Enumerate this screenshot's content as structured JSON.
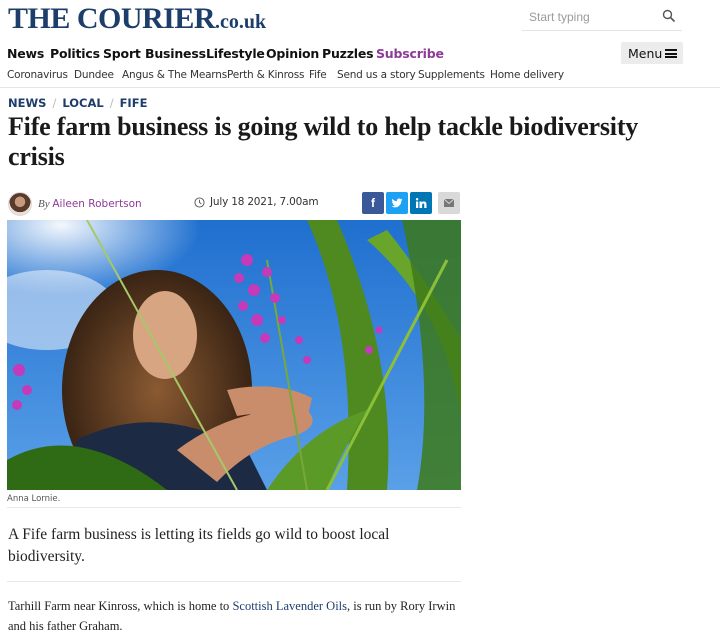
{
  "site": {
    "logo_main": "THE COURIER",
    "logo_tld": ".co.uk"
  },
  "search": {
    "placeholder": "Start typing",
    "icon": "search-icon"
  },
  "nav": {
    "items": [
      "News",
      "Politics",
      "Sport",
      "Business",
      "Lifestyle",
      "Opinion",
      "Puzzles",
      "Subscribe"
    ],
    "menu_label": "Menu",
    "subscribe_color": "#8e3a97"
  },
  "subnav": {
    "items": [
      "Coronavirus",
      "Dundee",
      "Angus & The Mearns",
      "Perth & Kinross",
      "Fife",
      "Send us a story",
      "Supplements",
      "Home delivery"
    ]
  },
  "breadcrumb": {
    "items": [
      "NEWS",
      "LOCAL",
      "FIFE"
    ],
    "separator": "/"
  },
  "article": {
    "headline": "Fife farm business is going wild to help tackle biodiversity crisis",
    "byline_prefix": "By",
    "author": "Aileen Robertson",
    "date": "July 18 2021, 7.00am",
    "share": {
      "facebook": "f",
      "email_icon": "email-icon"
    },
    "image_caption": "Anna Lornie.",
    "standfirst": "A Fife farm business is letting its fields go wild to boost local biodiversity.",
    "para1_before": "Tarhill Farm near Kinross, which is home to ",
    "para1_link": "Scottish Lavender Oils",
    "para1_after": ", is run by Rory Irwin and his father Graham."
  },
  "colors": {
    "brand_navy": "#1d3e6b",
    "author_purple": "#8e3a97",
    "facebook": "#3b5998",
    "twitter": "#1da1f2",
    "linkedin": "#0077b5"
  }
}
